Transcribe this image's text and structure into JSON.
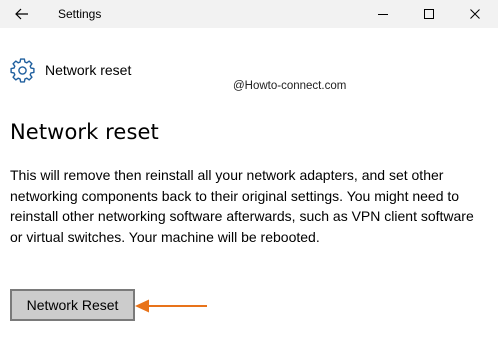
{
  "window": {
    "title": "Settings"
  },
  "header": {
    "label": "Network reset",
    "icon": "gear-icon"
  },
  "watermark": "@Howto-connect.com",
  "main": {
    "title": "Network reset",
    "description": "This will remove then reinstall all your network adapters, and set other networking components back to their original settings. You might need to reinstall other networking software afterwards, such as VPN client software or virtual switches. Your machine will be rebooted.",
    "button_label": "Network Reset"
  },
  "colors": {
    "titlebar_bg": "#f2f2f2",
    "button_bg": "#cccccc",
    "button_border": "#7a7a7a",
    "gear_blue": "#1f5f9e",
    "arrow_orange": "#e8731a"
  }
}
